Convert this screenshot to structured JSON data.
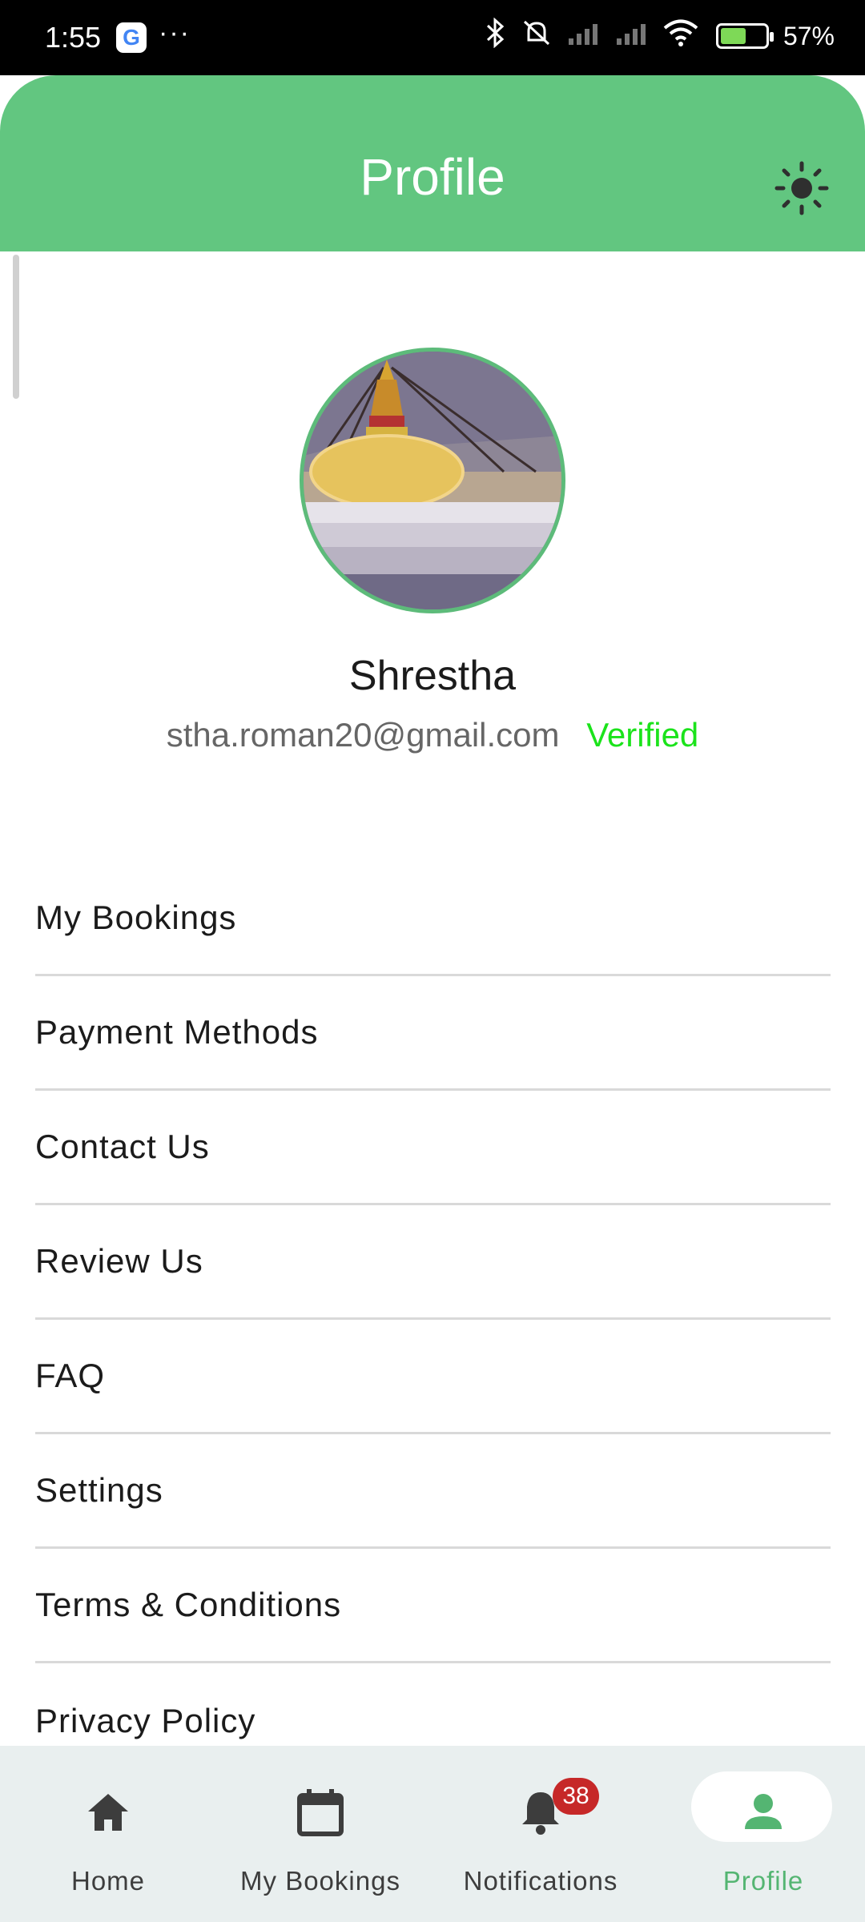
{
  "status_bar": {
    "time": "1:55",
    "more": "···",
    "battery": "57%",
    "battery_level": 0.57
  },
  "header": {
    "title": "Profile",
    "theme_icon": "sun-icon"
  },
  "profile": {
    "name": "Shrestha",
    "email": "stha.roman20@gmail.com",
    "verified_label": "Verified"
  },
  "menu": [
    {
      "label": "My Bookings"
    },
    {
      "label": "Payment Methods"
    },
    {
      "label": "Contact Us"
    },
    {
      "label": "Review Us"
    },
    {
      "label": "FAQ"
    },
    {
      "label": "Settings"
    },
    {
      "label": "Terms & Conditions"
    },
    {
      "label": "Privacy Policy"
    }
  ],
  "bottom_nav": [
    {
      "label": "Home",
      "icon": "home-icon"
    },
    {
      "label": "My Bookings",
      "icon": "calendar-icon"
    },
    {
      "label": "Notifications",
      "icon": "bell-icon",
      "badge": "38"
    },
    {
      "label": "Profile",
      "icon": "person-icon",
      "active": true
    }
  ],
  "colors": {
    "accent": "#62c680",
    "verified": "#1be31b",
    "badge": "#c62828",
    "active_nav": "#54b572"
  }
}
